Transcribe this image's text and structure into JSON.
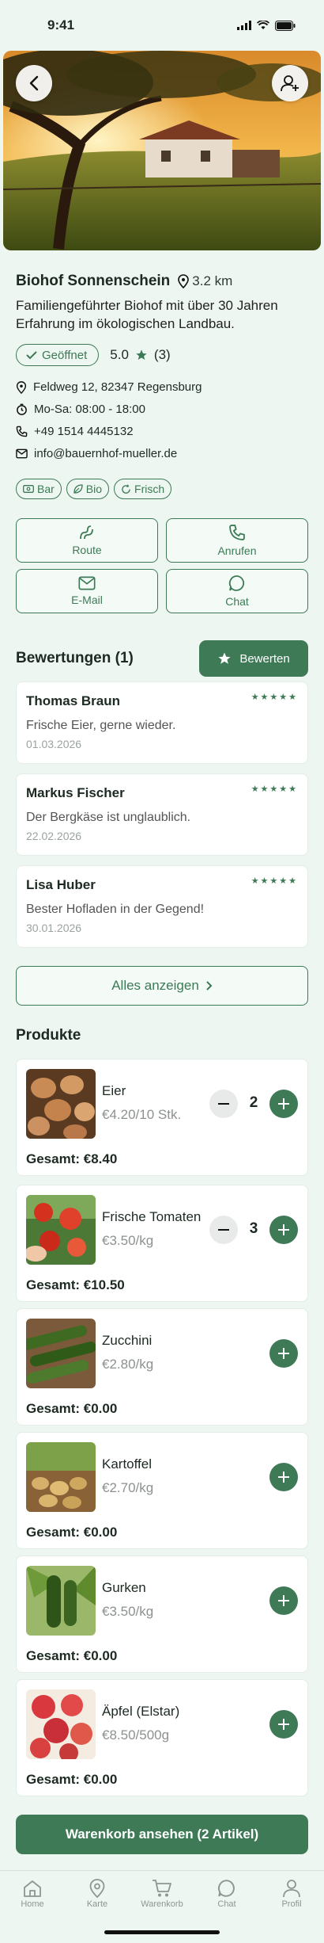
{
  "status_bar": {
    "time": "9:41"
  },
  "farm": {
    "name": "Biohof Sonnenschein",
    "distance": "3.2 km",
    "description": "Familiengeführter Biohof mit über 30 Jahren Erfahrung im ökologischen Landbau.",
    "open_status": "Geöffnet",
    "rating": "5.0",
    "rating_count": "(3)",
    "address": "Feldweg 12, 82347 Regensburg",
    "hours": "Mo-Sa: 08:00 - 18:00",
    "phone": "+49 1514 4445132",
    "email": "info@bauernhof-mueller.de",
    "tags": [
      "Bar",
      "Bio",
      "Frisch"
    ]
  },
  "actions": {
    "route": "Route",
    "call": "Anrufen",
    "email": "E-Mail",
    "chat": "Chat"
  },
  "reviews": {
    "title": "Bewertungen (1)",
    "rate_button": "Bewerten",
    "items": [
      {
        "name": "Thomas Braun",
        "text": "Frische Eier, gerne wieder.",
        "date": "01.03.2026",
        "stars": 5
      },
      {
        "name": "Markus Fischer",
        "text": "Der Bergkäse ist unglaublich.",
        "date": "22.02.2026",
        "stars": 5
      },
      {
        "name": "Lisa Huber",
        "text": "Bester Hofladen in der Gegend!",
        "date": "30.01.2026",
        "stars": 5
      }
    ],
    "show_all": "Alles anzeigen"
  },
  "products": {
    "title": "Produkte",
    "items": [
      {
        "name": "Eier",
        "price": "€4.20/10 Stk.",
        "total": "Gesamt: €8.40",
        "qty": "2"
      },
      {
        "name": "Frische Tomaten",
        "price": "€3.50/kg",
        "total": "Gesamt: €10.50",
        "qty": "3"
      },
      {
        "name": "Zucchini",
        "price": "€2.80/kg",
        "total": "Gesamt: €0.00",
        "qty": "0"
      },
      {
        "name": "Kartoffel",
        "price": "€2.70/kg",
        "total": "Gesamt: €0.00",
        "qty": "0"
      },
      {
        "name": "Gurken",
        "price": "€3.50/kg",
        "total": "Gesamt: €0.00",
        "qty": "0"
      },
      {
        "name": "Äpfel (Elstar)",
        "price": "€8.50/500g",
        "total": "Gesamt: €0.00",
        "qty": "0"
      }
    ]
  },
  "cart_button": "Warenkorb ansehen (2 Artikel)",
  "tabbar": [
    "Home",
    "Karte",
    "Warenkorb",
    "Chat",
    "Profil"
  ],
  "colors": {
    "accent": "#3f7a57",
    "background": "#eef6f1"
  }
}
